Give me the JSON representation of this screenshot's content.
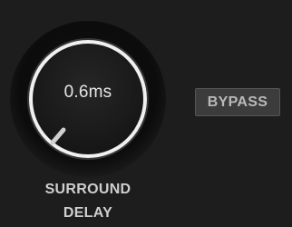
{
  "plugin": {
    "knob": {
      "value_display": "0.6ms",
      "label_line1": "SURROUND",
      "label_line2": "DELAY",
      "position_fraction": 0.04
    },
    "bypass": {
      "label": "BYPASS"
    }
  },
  "colors": {
    "background": "#1d1d1d",
    "knob_ring": "#e8e8e8",
    "button_face": "#3c3c3c",
    "text": "#cfcfcf"
  }
}
